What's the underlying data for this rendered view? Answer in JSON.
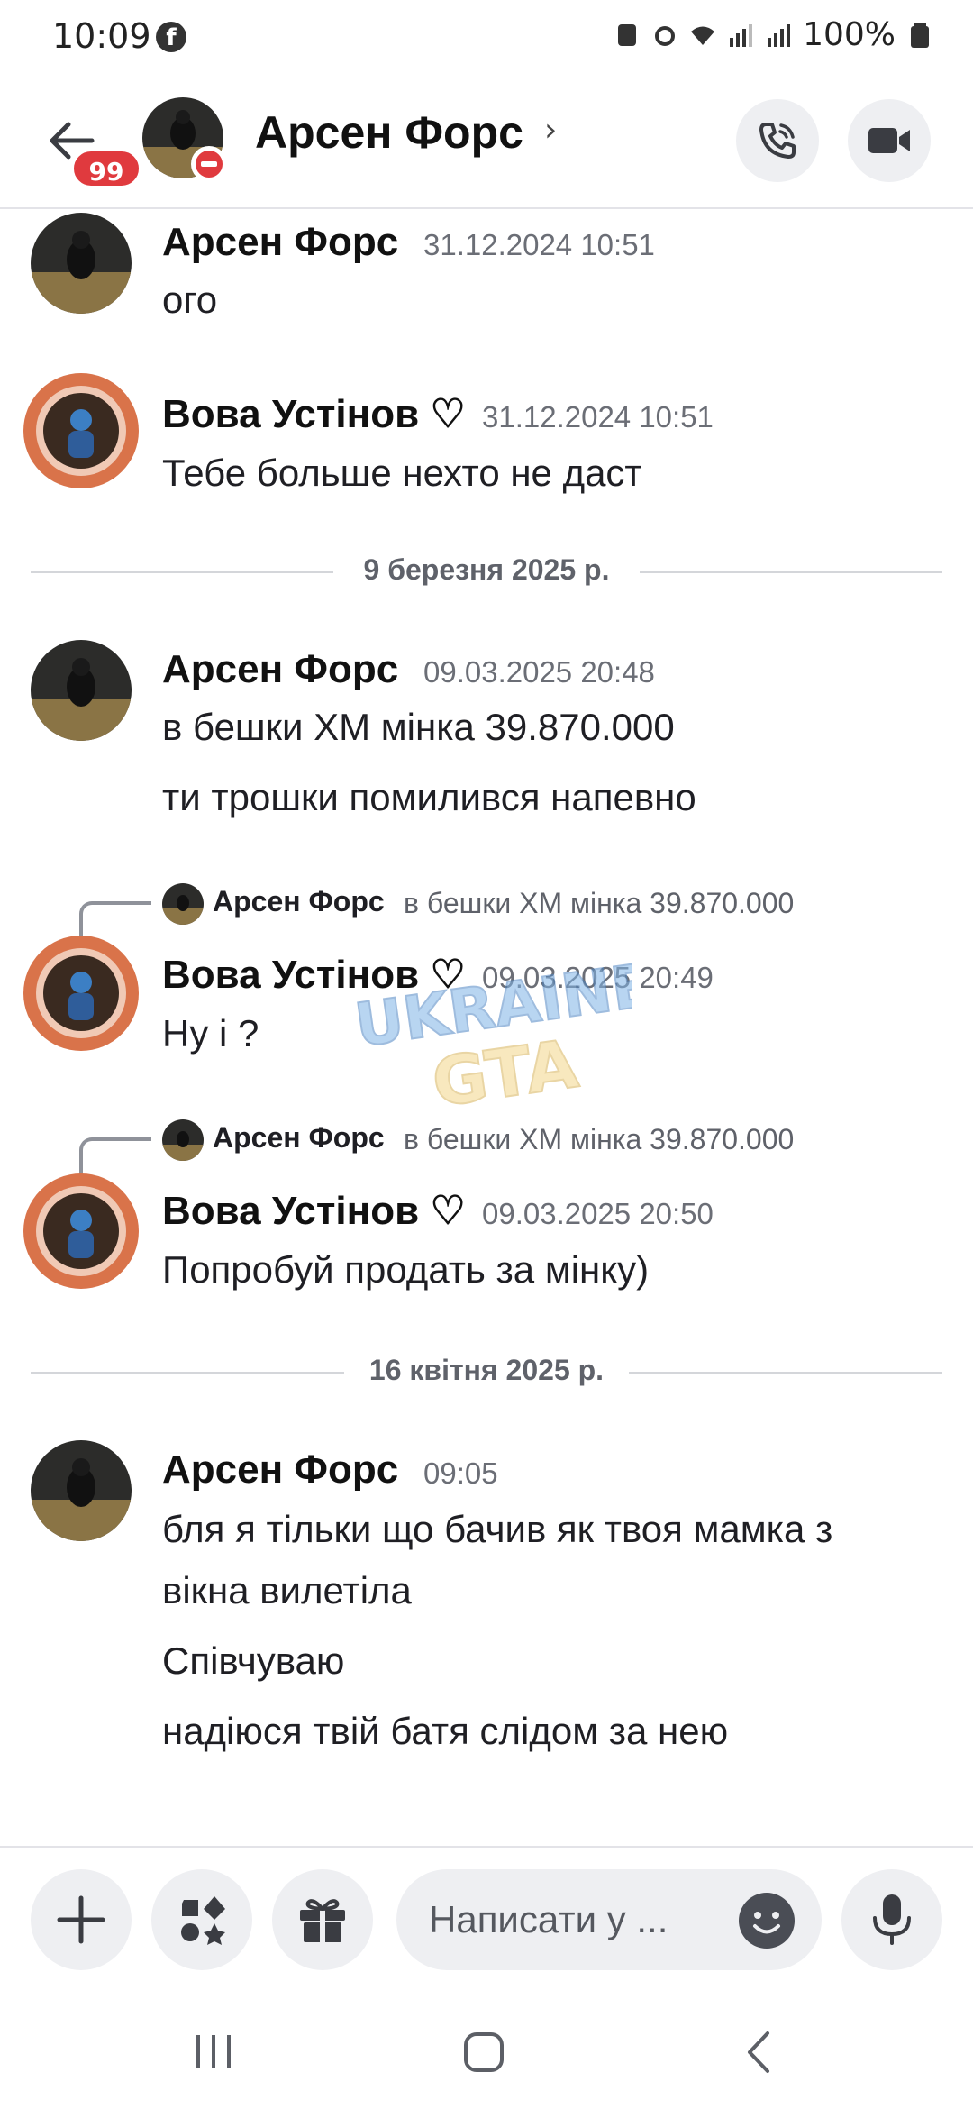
{
  "status_bar": {
    "time": "10:09",
    "battery": "100%"
  },
  "header": {
    "unread_count": "99",
    "contact_name": "Арсен Форс",
    "chevron": "›"
  },
  "messages": [
    {
      "author": "Арсен Форс",
      "timestamp": "31.12.2024 10:51",
      "lines": [
        "ого"
      ]
    },
    {
      "author": "Вова Устінов ♡",
      "timestamp": "31.12.2024 10:51",
      "lines": [
        "Тебе больше нехто не даст"
      ]
    },
    {
      "author": "Арсен Форс",
      "timestamp": "09.03.2025 20:48",
      "lines": [
        "в бешки ХМ мінка 39.870.000",
        "ти трошки помилився напевно"
      ]
    },
    {
      "reply_to_author": "Арсен Форс",
      "reply_to_text": "в бешки ХМ мінка 39.870.000",
      "author": "Вова Устінов ♡",
      "timestamp": "09.03.2025 20:49",
      "lines": [
        "Ну і ?"
      ]
    },
    {
      "reply_to_author": "Арсен Форс",
      "reply_to_text": "в бешки ХМ мінка 39.870.000",
      "author": "Вова Устінов ♡",
      "timestamp": "09.03.2025 20:50",
      "lines": [
        "Попробуй продать за мінку)"
      ]
    },
    {
      "author": "Арсен Форс",
      "timestamp": "09:05",
      "lines": [
        "бля я тільки що бачив як твоя мамка з",
        "вікна вилетіла",
        "Співчуваю",
        "надіюся твій батя слідом за нею"
      ]
    }
  ],
  "dividers": [
    "9 березня 2025 р.",
    "16 квітня 2025 р."
  ],
  "watermark": {
    "line1": "UKRAINE",
    "line2": "GTA"
  },
  "composer": {
    "placeholder": "Написати у ..."
  },
  "colors": {
    "badge": "#e03a3e",
    "button_bg": "#eeeff2",
    "timestamp": "#6b6e76"
  }
}
